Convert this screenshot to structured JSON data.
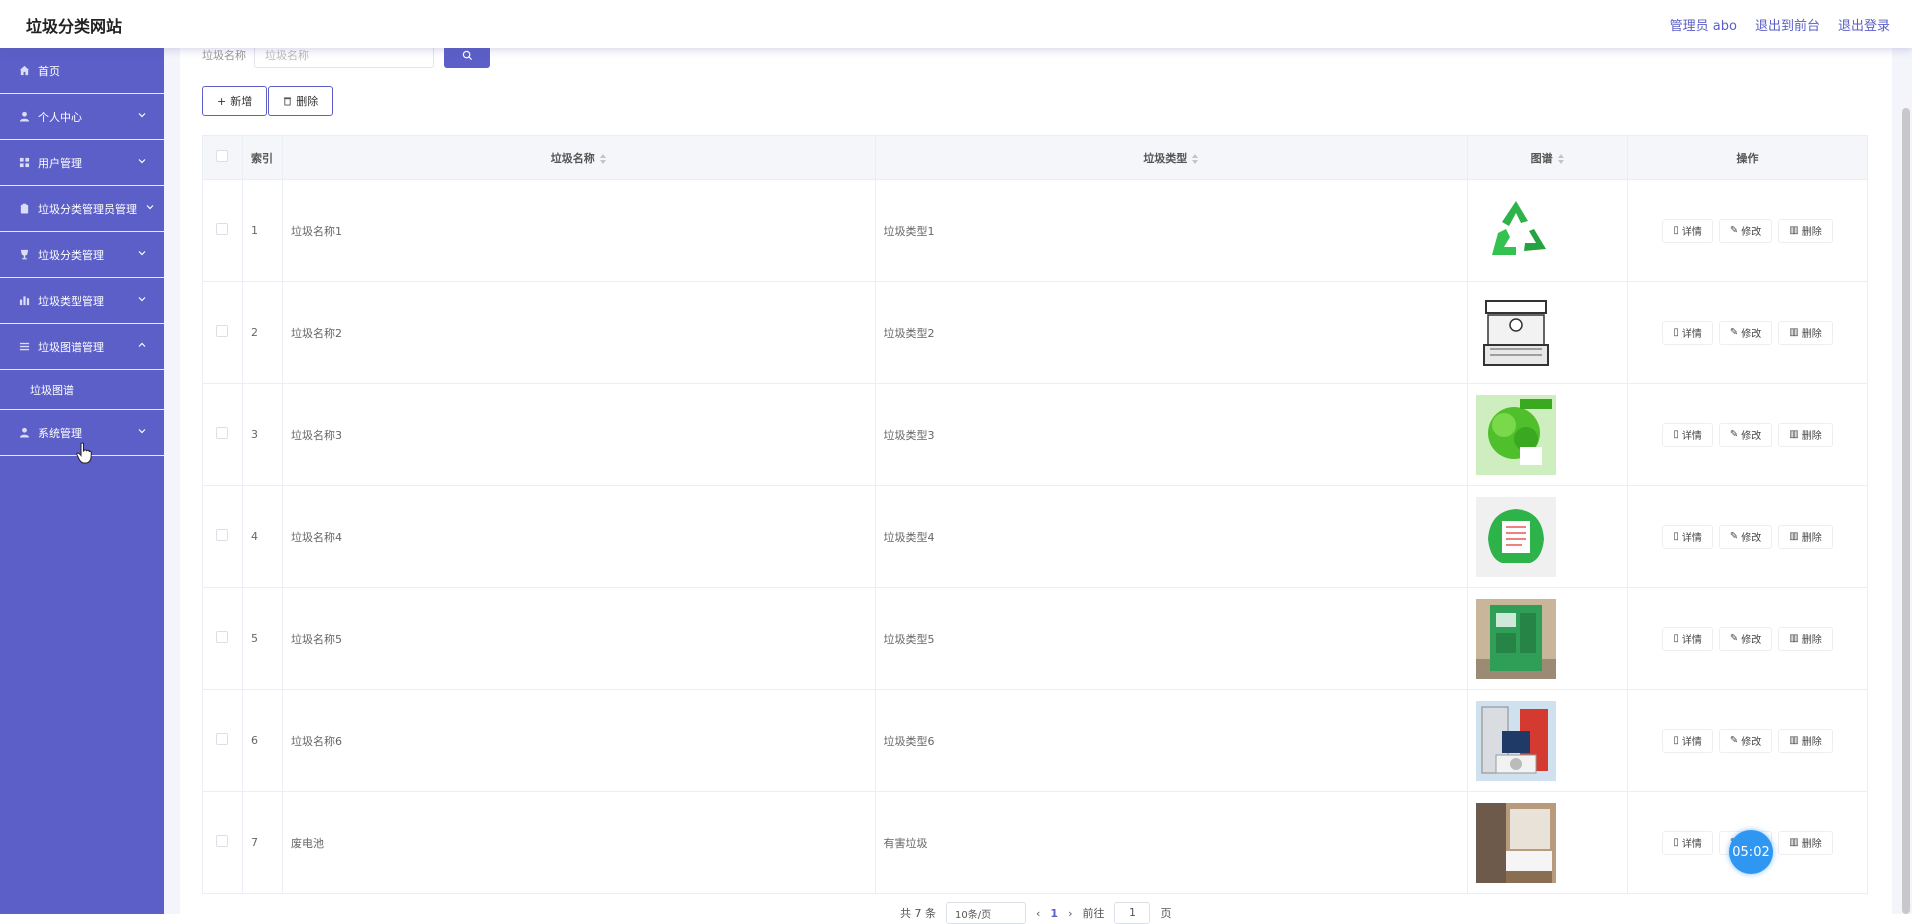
{
  "header": {
    "brand": "垃圾分类网站",
    "user": "管理员 abo",
    "back_to_front": "退出到前台",
    "logout": "退出登录"
  },
  "sidebar": {
    "items": [
      {
        "label": "首页",
        "icon": "home-icon",
        "expandable": false
      },
      {
        "label": "个人中心",
        "icon": "user-icon",
        "expandable": true
      },
      {
        "label": "用户管理",
        "icon": "grid-icon",
        "expandable": true
      },
      {
        "label": "垃圾分类管理员管理",
        "icon": "clipboard-icon",
        "expandable": true
      },
      {
        "label": "垃圾分类管理",
        "icon": "trophy-icon",
        "expandable": true
      },
      {
        "label": "垃圾类型管理",
        "icon": "bar-chart-icon",
        "expandable": true
      },
      {
        "label": "垃圾图谱管理",
        "icon": "list-icon",
        "expandable": true,
        "expanded": true
      },
      {
        "label": "系统管理",
        "icon": "user-icon",
        "expandable": true
      }
    ],
    "sub_items": [
      "垃圾图谱"
    ]
  },
  "search": {
    "label": "垃圾名称",
    "placeholder": "垃圾名称"
  },
  "toolbar": {
    "add_label": "新增",
    "delete_label": "删除"
  },
  "table": {
    "headers": {
      "index": "索引",
      "name": "垃圾名称",
      "type": "垃圾类型",
      "image": "图谱",
      "ops": "操作"
    },
    "rows": [
      {
        "index": "1",
        "name": "垃圾名称1",
        "type": "垃圾类型1",
        "image": "recycle-symbol"
      },
      {
        "index": "2",
        "name": "垃圾名称2",
        "type": "垃圾类型2",
        "image": "sketch-kiosk"
      },
      {
        "index": "3",
        "name": "垃圾名称3",
        "type": "垃圾类型3",
        "image": "green-tree-poster"
      },
      {
        "index": "4",
        "name": "垃圾名称4",
        "type": "垃圾类型4",
        "image": "green-house-sign"
      },
      {
        "index": "5",
        "name": "垃圾名称5",
        "type": "垃圾类型5",
        "image": "recycling-bin-machine"
      },
      {
        "index": "6",
        "name": "垃圾名称6",
        "type": "垃圾类型6",
        "image": "home-appliances"
      },
      {
        "index": "7",
        "name": "废电池",
        "type": "有害垃圾",
        "image": "hotel-room"
      }
    ],
    "op_labels": {
      "detail": "详情",
      "edit": "修改",
      "delete": "删除"
    }
  },
  "pagination": {
    "total": "共 7 条",
    "page_size": "10条/页",
    "current": "1",
    "goto_prefix": "前往",
    "goto_value": "1",
    "goto_suffix": "页"
  },
  "timer": "05:02",
  "colors": {
    "accent": "#5b5fc7",
    "timer": "#2f97f1"
  }
}
